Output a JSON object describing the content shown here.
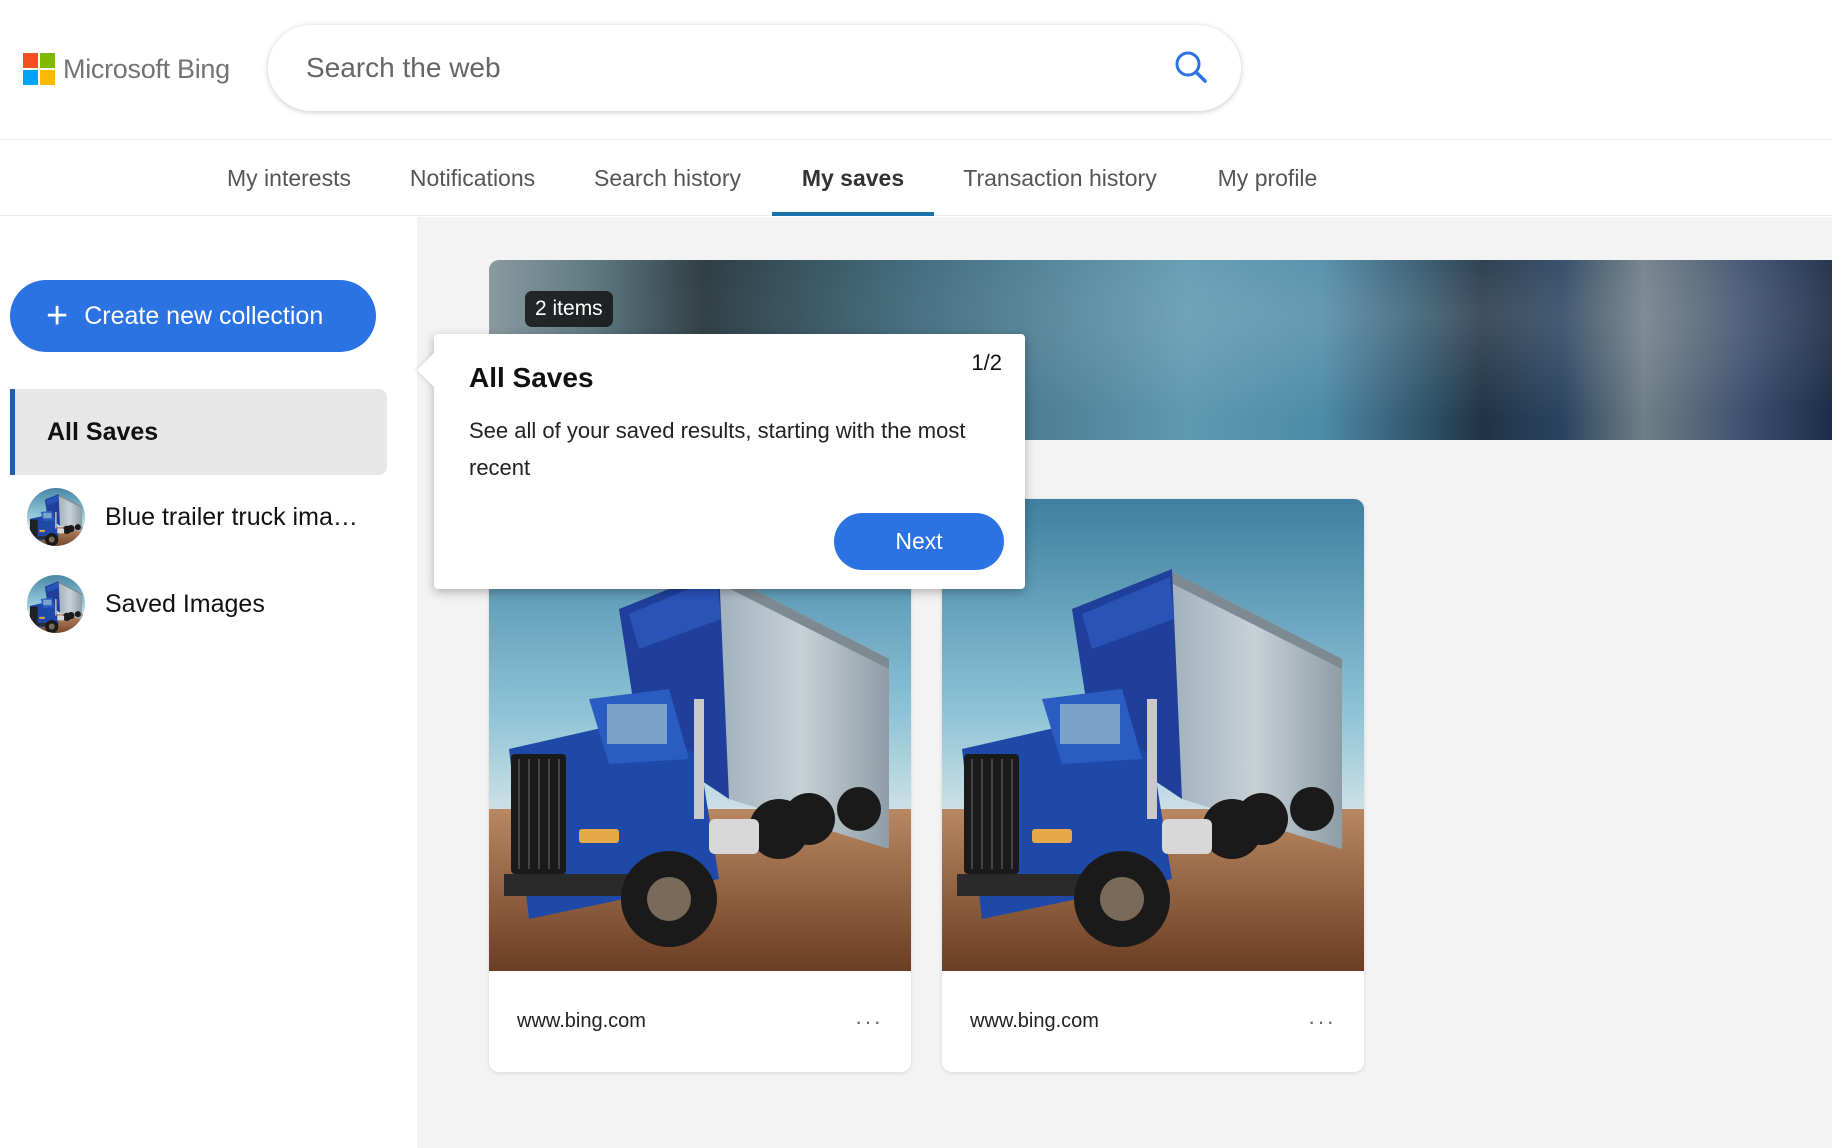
{
  "header": {
    "brand": "Microsoft Bing",
    "brand_colors": [
      "#f25022",
      "#7fba00",
      "#00a4ef",
      "#ffb900"
    ],
    "search": {
      "placeholder": "Search the web",
      "value": "",
      "icon": "search-icon"
    }
  },
  "tabs": [
    {
      "label": "My interests",
      "active": false
    },
    {
      "label": "Notifications",
      "active": false
    },
    {
      "label": "Search history",
      "active": false
    },
    {
      "label": "My saves",
      "active": true
    },
    {
      "label": "Transaction history",
      "active": false
    },
    {
      "label": "My profile",
      "active": false
    }
  ],
  "sidebar": {
    "create_label": "Create new collection",
    "all_saves_label": "All Saves",
    "collections": [
      {
        "label": "Blue trailer truck ima…",
        "thumb": "truck-thumbnail"
      },
      {
        "label": "Saved Images",
        "thumb": "truck-thumbnail"
      }
    ]
  },
  "main": {
    "items_badge": "2 items",
    "cards": [
      {
        "source": "www.bing.com",
        "more": "···",
        "image": "blue-truck-image"
      },
      {
        "source": "www.bing.com",
        "more": "···",
        "image": "blue-truck-image"
      }
    ]
  },
  "tooltip": {
    "title": "All Saves",
    "step": "1/2",
    "body": "See all of your saved results, starting with the most recent",
    "next_label": "Next"
  },
  "colors": {
    "accent": "#2b73e3",
    "active_tab_underline": "#1a73a8",
    "sidebar_active_border": "#1a5fb4",
    "content_background": "#f3f3f3"
  }
}
